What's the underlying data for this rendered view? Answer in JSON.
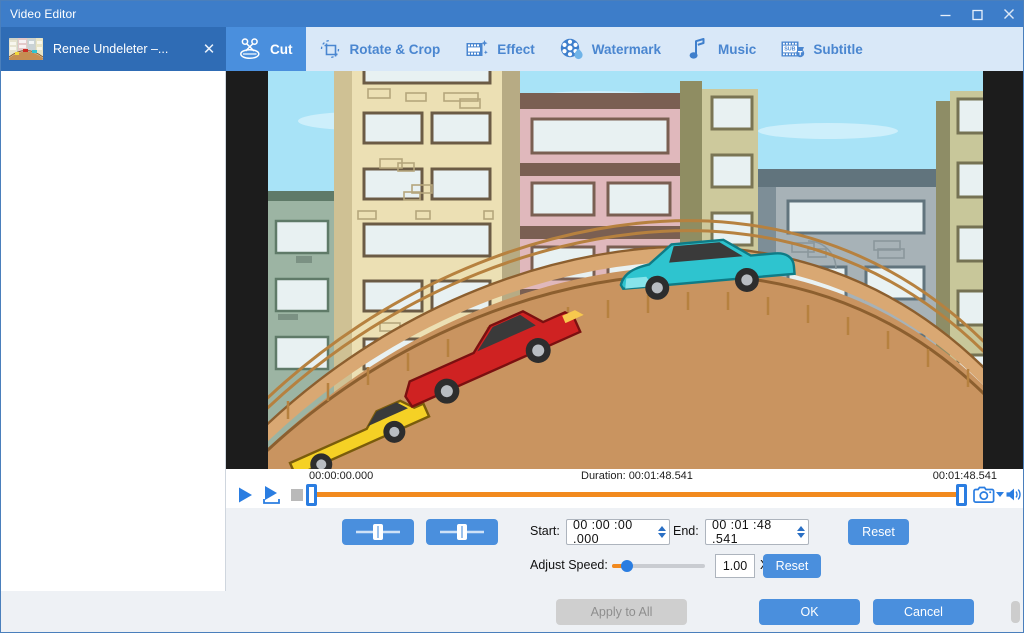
{
  "window": {
    "title": "Video Editor",
    "controls": [
      {
        "name": "minimize",
        "glyph": "minimize-icon"
      },
      {
        "name": "maximize",
        "glyph": "maximize-icon"
      },
      {
        "name": "close",
        "glyph": "close-icon"
      }
    ]
  },
  "file_tab": {
    "name": "Renee Undeleter –...",
    "close_label": "✕",
    "thumbnail": "video-thumbnail-icon"
  },
  "toolbar": {
    "tabs": [
      {
        "label": "Cut",
        "icon": "scissors-icon",
        "active": true
      },
      {
        "label": "Rotate & Crop",
        "icon": "rotate-crop-icon",
        "active": false
      },
      {
        "label": "Effect",
        "icon": "film-sparkle-icon",
        "active": false
      },
      {
        "label": "Watermark",
        "icon": "film-droplet-icon",
        "active": false
      },
      {
        "label": "Music",
        "icon": "music-note-icon",
        "active": false
      },
      {
        "label": "Subtitle",
        "icon": "subtitle-icon",
        "active": false
      }
    ]
  },
  "preview": {
    "alt": "Cartoon city street scene with bridge and cars",
    "background_color": "#1c1c1c"
  },
  "timeline": {
    "start_time": "00:00:00.000",
    "duration_label": "Duration: 00:01:48.541",
    "end_time": "00:01:48.541",
    "track_color": "#f28a1e",
    "handle_color": "#2a7de1",
    "buttons": [
      {
        "name": "play-button",
        "icon": "play-icon"
      },
      {
        "name": "play-selection-button",
        "icon": "play-selection-icon"
      },
      {
        "name": "stop-button",
        "icon": "stop-icon"
      },
      {
        "name": "snapshot-button",
        "icon": "camera-icon"
      },
      {
        "name": "snapshot-dropdown",
        "icon": "chevron-down-icon"
      },
      {
        "name": "volume-button",
        "icon": "volume-icon"
      }
    ]
  },
  "controls": {
    "trim_start_button": "set-start-marker",
    "trim_end_button": "set-end-marker",
    "start_label": "Start:",
    "start_value": "00 :00 :00 .000",
    "end_label": "End:",
    "end_value": "00 :01 :48 .541",
    "reset_time_label": "Reset",
    "speed_label": "Adjust Speed:",
    "speed_value": "1.00",
    "speed_unit": "X",
    "reset_speed_label": "Reset"
  },
  "footer": {
    "apply_to_all": "Apply to All",
    "ok": "OK",
    "cancel": "Cancel"
  },
  "colors": {
    "accent_blue": "#4a8fdd",
    "titlebar_blue": "#3d7dc9",
    "orange": "#f28a1e",
    "panel_bg": "#eef1f5"
  }
}
